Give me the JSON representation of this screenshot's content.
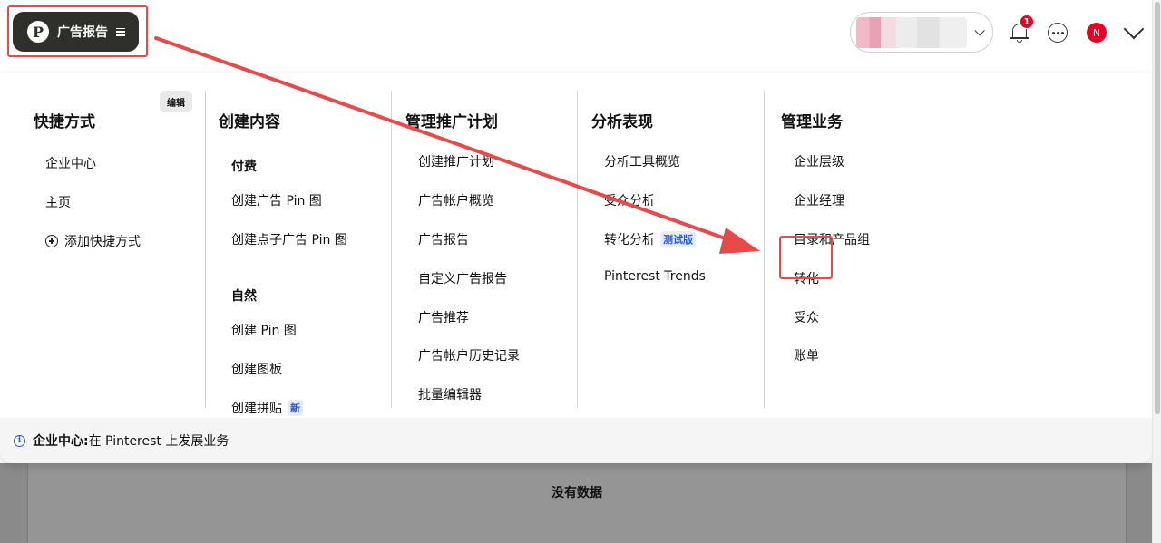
{
  "header": {
    "brand_logo_letter": "P",
    "brand_label": "广告报告",
    "notification_count": "1",
    "avatar_letter": "N"
  },
  "menu": {
    "shortcuts": {
      "title": "快捷方式",
      "edit_label": "编辑",
      "items": [
        "企业中心",
        "主页"
      ],
      "add_label": "添加快捷方式"
    },
    "create": {
      "title": "创建内容",
      "paid_label": "付费",
      "paid_items": [
        "创建广告 Pin 图",
        "创建点子广告 Pin 图"
      ],
      "organic_label": "自然",
      "organic_items": [
        "创建 Pin 图",
        "创建图板",
        "创建拼贴"
      ],
      "new_tag": "新"
    },
    "campaigns": {
      "title": "管理推广计划",
      "items": [
        "创建推广计划",
        "广告帐户概览",
        "广告报告",
        "自定义广告报告",
        "广告推荐",
        "广告帐户历史记录",
        "批量编辑器"
      ]
    },
    "analytics": {
      "title": "分析表现",
      "items": [
        "分析工具概览",
        "受众分析",
        "转化分析",
        "Pinterest Trends"
      ],
      "beta_tag": "测试版"
    },
    "business": {
      "title": "管理业务",
      "items": [
        "企业层级",
        "企业经理",
        "目录和产品组",
        "转化",
        "受众",
        "账单"
      ]
    }
  },
  "footer": {
    "info_icon_glyph": "i",
    "bold_text": "企业中心:",
    "text": " 在 Pinterest 上发展业务"
  },
  "background": {
    "no_data_text": "没有数据"
  },
  "colors": {
    "annotation_red": "#e84a4a",
    "brand_dark": "#2f2f2b",
    "pinterest_red": "#e60023",
    "tag_blue": "#2a55d6"
  }
}
